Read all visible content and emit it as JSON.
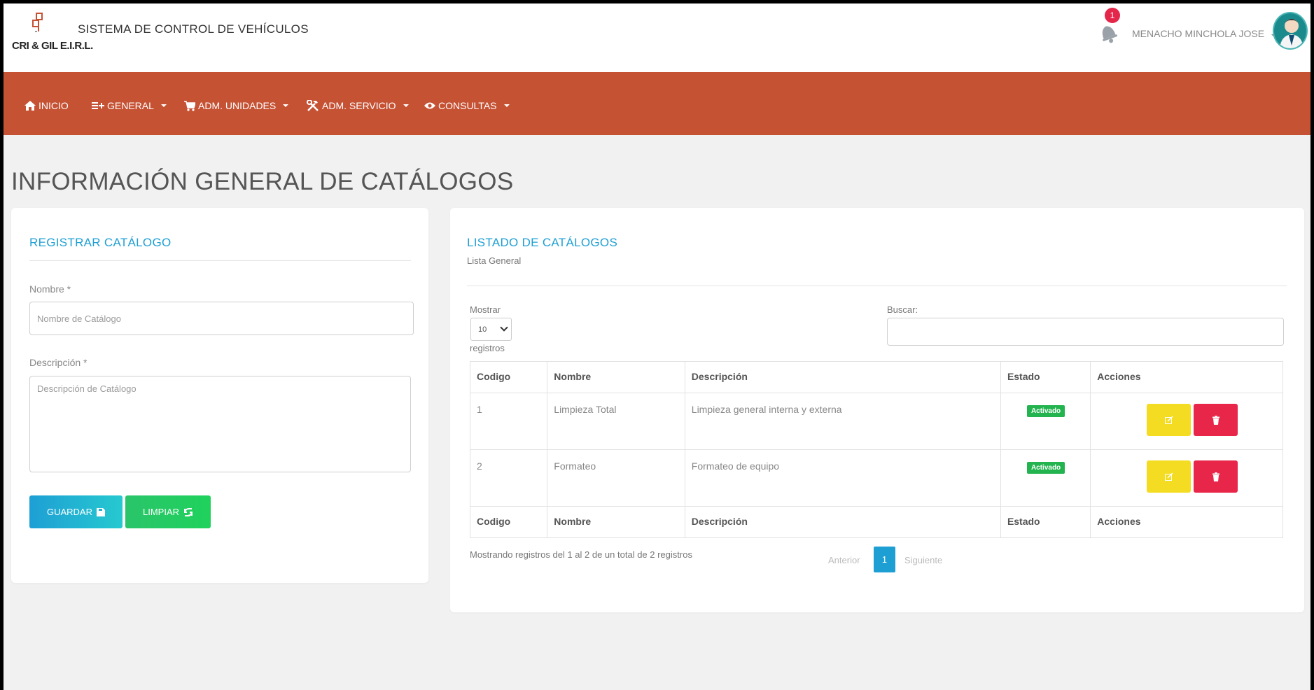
{
  "header": {
    "logo_text": "CRI & GIL E.I.R.L.",
    "app_title": "SISTEMA DE CONTROL DE VEHÍCULOS",
    "notification_count": "1",
    "user_name": "MENACHO MINCHOLA JOSE"
  },
  "nav": {
    "inicio": "INICIO",
    "general": "GENERAL",
    "adm_unidades": "ADM. UNIDADES",
    "adm_servicio": "ADM. SERVICIO",
    "consultas": "CONSULTAS"
  },
  "colors": {
    "navbar": "#c65234",
    "accent": "#1e9fd4",
    "success": "#23b44f",
    "warning": "#f4dc22",
    "danger": "#e7264a"
  },
  "page_title": "INFORMACIÓN GENERAL DE CATÁLOGOS",
  "form": {
    "title": "REGISTRAR CATÁLOGO",
    "nombre_label": "Nombre *",
    "nombre_placeholder": "Nombre de Catálogo",
    "descripcion_label": "Descripción *",
    "descripcion_placeholder": "Descripción de Catálogo",
    "guardar_label": "GUARDAR",
    "limpiar_label": "LIMPIAR"
  },
  "list": {
    "title": "LISTADO DE CATÁLOGOS",
    "subtitle": "Lista General",
    "show_label": "Mostrar",
    "show_value": "10",
    "records_label": "registros",
    "search_label": "Buscar:",
    "columns": [
      "Codigo",
      "Nombre",
      "Descripción",
      "Estado",
      "Acciones"
    ],
    "rows": [
      {
        "codigo": "1",
        "nombre": "Limpieza Total",
        "descripcion": "Limpieza general interna y externa",
        "estado": "Activado"
      },
      {
        "codigo": "2",
        "nombre": "Formateo",
        "descripcion": "Formateo de equipo",
        "estado": "Activado"
      }
    ],
    "info": "Mostrando registros del 1 al 2 de un total de 2 registros",
    "prev": "Anterior",
    "page": "1",
    "next": "Siguiente"
  }
}
